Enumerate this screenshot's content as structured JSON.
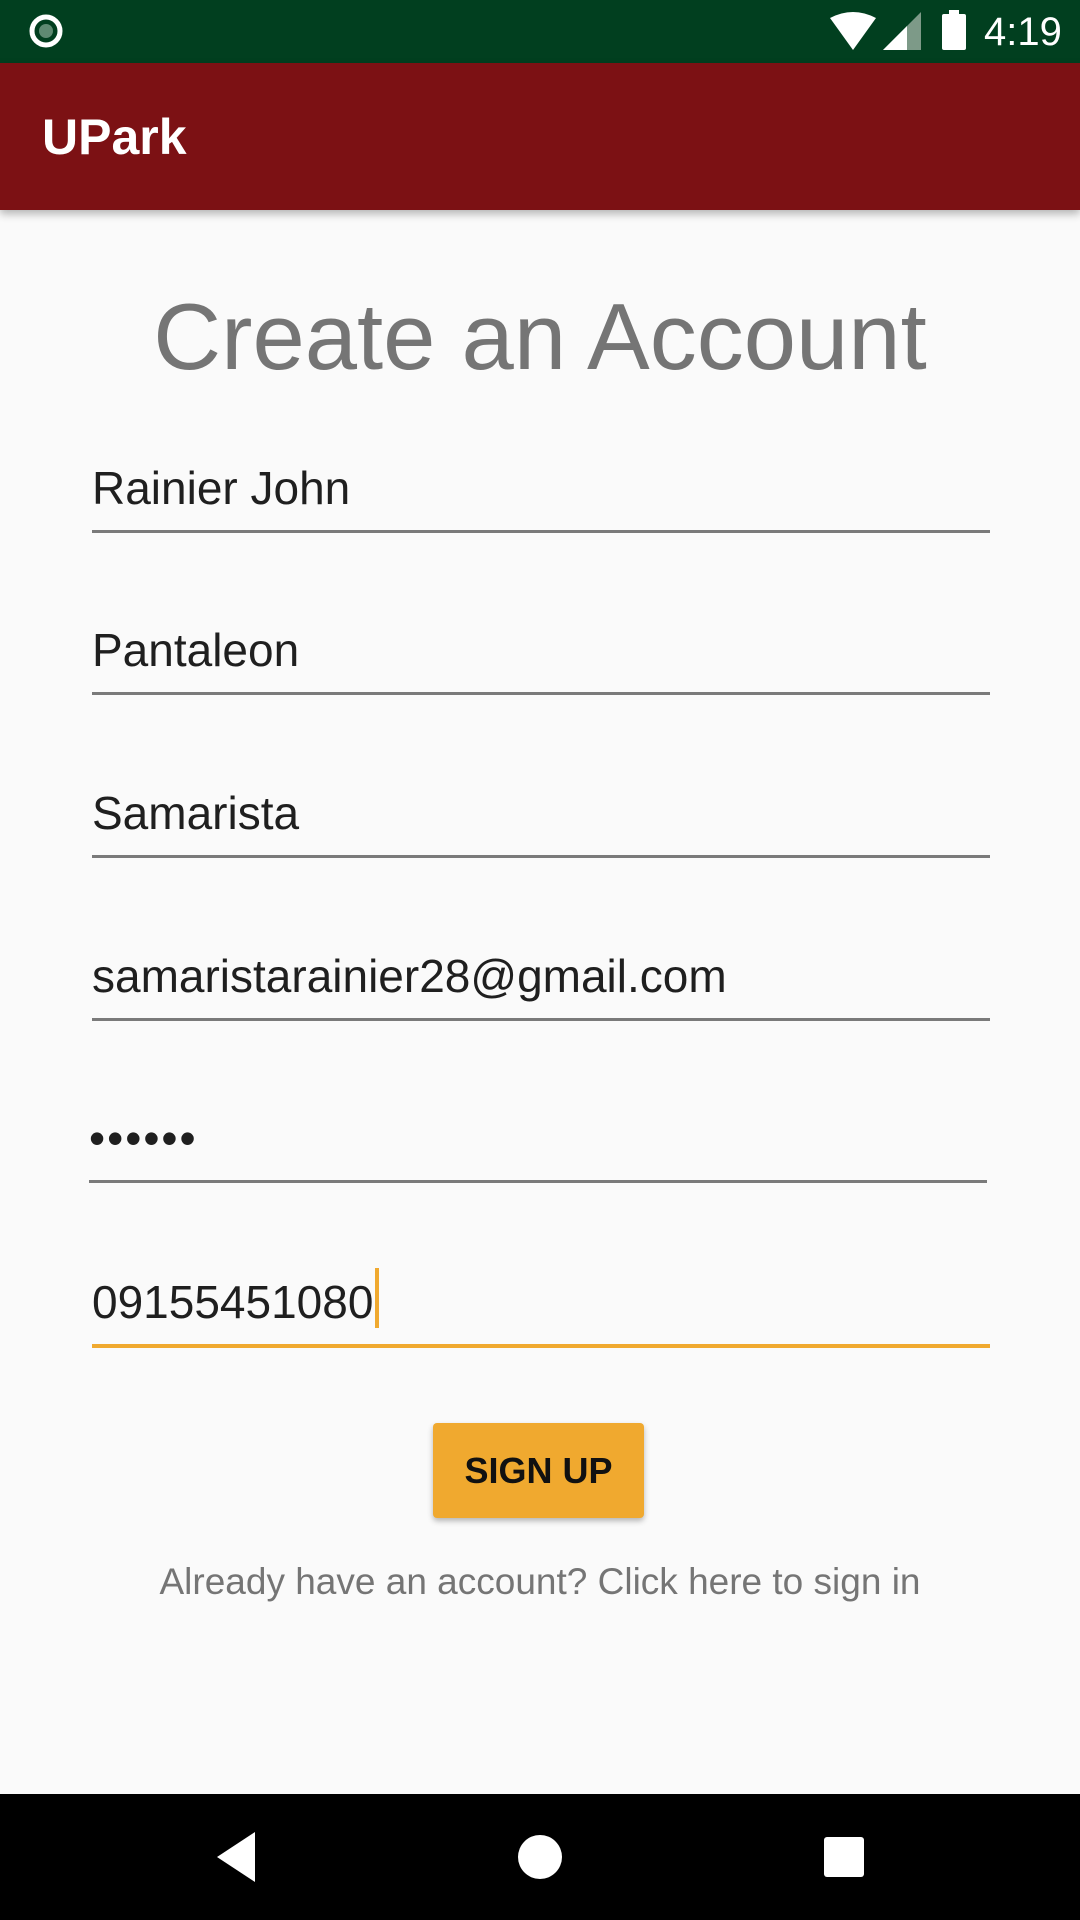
{
  "status_bar": {
    "time": "4:19",
    "icons": [
      "notification-icon",
      "wifi-icon",
      "cell-signal-icon",
      "battery-icon"
    ]
  },
  "app_bar": {
    "title": "UPark",
    "color": "#7c1114"
  },
  "form": {
    "title": "Create an Account",
    "fields": [
      {
        "name": "first-name",
        "value": "Rainier John"
      },
      {
        "name": "middle-name",
        "value": "Pantaleon"
      },
      {
        "name": "last-name",
        "value": "Samarista"
      },
      {
        "name": "email",
        "value": "samaristarainier28@gmail.com"
      },
      {
        "name": "password",
        "value": "••••••"
      },
      {
        "name": "phone",
        "value": "09155451080",
        "focused": true
      }
    ],
    "submit_label": "SIGN UP",
    "signin_link": "Already have an account? Click here to sign in"
  },
  "theme": {
    "accent": "#f0a92f",
    "status_bar": "#013f1f",
    "primary": "#7c1114"
  },
  "nav_bar": {
    "icons": [
      "back-icon",
      "home-icon",
      "recents-icon"
    ]
  }
}
